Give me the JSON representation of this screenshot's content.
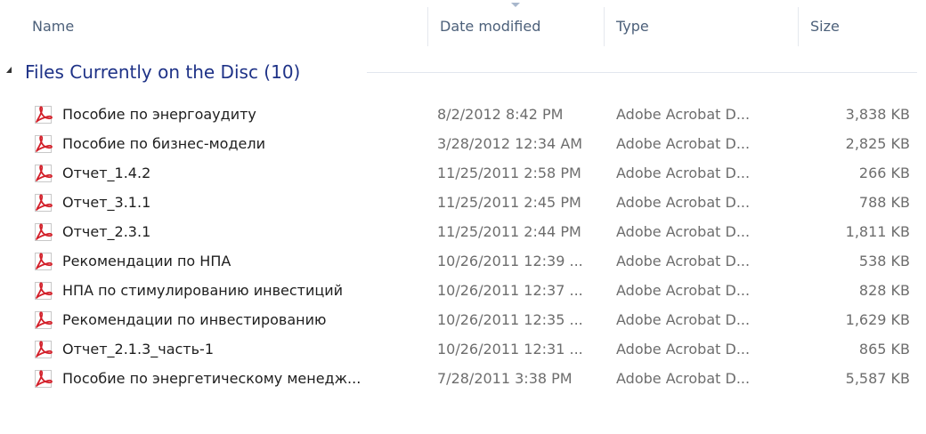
{
  "columns": {
    "name": "Name",
    "date": "Date modified",
    "type": "Type",
    "size": "Size"
  },
  "group": {
    "title": "Files Currently on the Disc (10)"
  },
  "files": [
    {
      "name": "Пособие по энергоаудиту",
      "date": "8/2/2012 8:42 PM",
      "type": "Adobe Acrobat D...",
      "size": "3,838 KB",
      "icon": "pdf-icon"
    },
    {
      "name": "Пособие по бизнес-модели",
      "date": "3/28/2012 12:34 AM",
      "type": "Adobe Acrobat D...",
      "size": "2,825 KB",
      "icon": "pdf-icon"
    },
    {
      "name": "Отчет_1.4.2",
      "date": "11/25/2011 2:58 PM",
      "type": "Adobe Acrobat D...",
      "size": "266 KB",
      "icon": "pdf-icon"
    },
    {
      "name": "Отчет_3.1.1",
      "date": "11/25/2011 2:45 PM",
      "type": "Adobe Acrobat D...",
      "size": "788 KB",
      "icon": "pdf-icon"
    },
    {
      "name": "Отчет_2.3.1",
      "date": "11/25/2011 2:44 PM",
      "type": "Adobe Acrobat D...",
      "size": "1,811 KB",
      "icon": "pdf-icon"
    },
    {
      "name": "Рекомендации по НПА",
      "date": "10/26/2011 12:39 ...",
      "type": "Adobe Acrobat D...",
      "size": "538 KB",
      "icon": "pdf-icon"
    },
    {
      "name": "НПА по стимулированию инвестиций",
      "date": "10/26/2011 12:37 ...",
      "type": "Adobe Acrobat D...",
      "size": "828 KB",
      "icon": "pdf-icon"
    },
    {
      "name": "Рекомендации по инвестированию",
      "date": "10/26/2011 12:35 ...",
      "type": "Adobe Acrobat D...",
      "size": "1,629 KB",
      "icon": "pdf-icon"
    },
    {
      "name": "Отчет_2.1.3_часть-1",
      "date": "10/26/2011 12:31 ...",
      "type": "Adobe Acrobat D...",
      "size": "865 KB",
      "icon": "pdf-icon"
    },
    {
      "name": "Пособие по энергетическому менедж...",
      "date": "7/28/2011 3:38 PM",
      "type": "Adobe Acrobat D...",
      "size": "5,587 KB",
      "icon": "pdf-icon"
    }
  ],
  "colors": {
    "header_text": "#4c607a",
    "group_title": "#1e3287",
    "pdf_red": "#d3202a"
  }
}
